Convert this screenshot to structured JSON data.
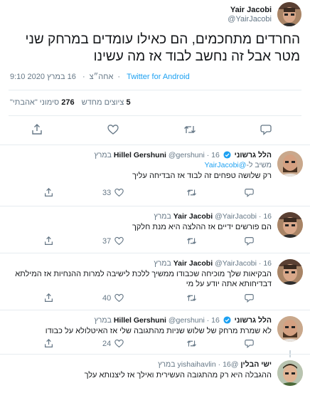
{
  "main_tweet": {
    "author_name": "Yair Jacobi",
    "author_handle": "@YairJacobi",
    "text": "החרדים מתחכמים, הם כאילו עומדים במרחק שני מטר אבל זה נחשב לבוד אז מה עשינו",
    "time": "9:10 אחה״צ",
    "date": "16 במרץ 2020",
    "source": "Twitter for Android",
    "separator": "·",
    "retweets_count": "5",
    "retweets_label": "ציוצים מחדש",
    "likes_count": "276",
    "likes_label": "סימוני \"אהבתי\""
  },
  "replies": [
    {
      "name": "הלל גרשוני",
      "handle_name": "Hillel Gershuni",
      "handle": "@gershuni",
      "date": "16 במרץ",
      "verified": true,
      "reply_to_label": "משיב ל-",
      "reply_to": "@YairJacobi",
      "text": "רק שלושה טפחים זה לבוד אז הבדיחה עליך",
      "retweets": "",
      "likes": "33"
    },
    {
      "name": "Yair Jacobi",
      "handle_name": "",
      "handle": "@YairJacobi",
      "date": "16 במרץ",
      "verified": false,
      "reply_to_label": "",
      "reply_to": "",
      "text": "הם פורשים ידיים אז ההלצה היא מנת חלקך",
      "retweets": "",
      "likes": "37"
    },
    {
      "name": "Yair Jacobi",
      "handle_name": "",
      "handle": "@YairJacobi",
      "date": "16 במרץ",
      "verified": false,
      "reply_to_label": "",
      "reply_to": "",
      "text": "הבקיאות שלך מוכיחה שכבודו ממשיך ללכת לישיבה למרות ההנחיות אז המילתא דבדיחותא אתה יודע על מי",
      "retweets": "",
      "likes": "40"
    },
    {
      "name": "הלל גרשוני",
      "handle_name": "Hillel Gershuni",
      "handle": "@gershuni",
      "date": "16 במרץ",
      "verified": true,
      "reply_to_label": "",
      "reply_to": "",
      "text": "לא שמרת מרחק של שלוש שניות מהתגובה שלי אז האיטלולא על כבודו",
      "retweets": "",
      "likes": "24"
    },
    {
      "name": "ישי הבלין",
      "handle_name": "",
      "handle": "@yishaihavlin",
      "date": "16 במרץ",
      "verified": false,
      "reply_to_label": "",
      "reply_to": "",
      "text": "ההגבלה היא רק מהתגובה העשירית ואילך אז ליצנותא עלך",
      "retweets": "",
      "likes": ""
    }
  ],
  "icons": {
    "reply": "reply-icon",
    "retweet": "retweet-icon",
    "like": "heart-icon",
    "share": "share-icon",
    "verified": "verified-badge-icon"
  },
  "colors": {
    "accent": "#1da1f2",
    "text": "#14171a",
    "muted": "#657786",
    "border": "#e6ecf0"
  }
}
